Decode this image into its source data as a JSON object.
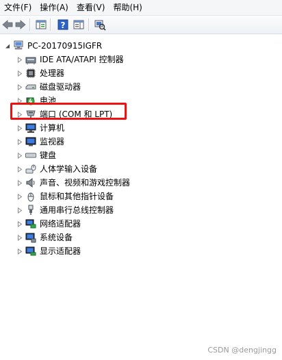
{
  "menubar": {
    "items": [
      "文件(F)",
      "操作(A)",
      "查看(V)",
      "帮助(H)"
    ]
  },
  "toolbar": {
    "buttons": [
      "back-arrow-icon",
      "forward-arrow-icon",
      "show-hide-tree-icon",
      "help-icon",
      "properties-icon",
      "scan-hardware-icon"
    ]
  },
  "tree": {
    "root": "PC-20170915IGFR",
    "categories": [
      {
        "label": "IDE ATA/ATAPI 控制器",
        "icon": "ide-controller-icon"
      },
      {
        "label": "处理器",
        "icon": "processor-icon"
      },
      {
        "label": "磁盘驱动器",
        "icon": "disk-drive-icon"
      },
      {
        "label": "电池",
        "icon": "battery-icon"
      },
      {
        "label": "端口 (COM 和 LPT)",
        "icon": "port-icon"
      },
      {
        "label": "计算机",
        "icon": "computer-icon"
      },
      {
        "label": "监视器",
        "icon": "monitor-icon"
      },
      {
        "label": "键盘",
        "icon": "keyboard-icon"
      },
      {
        "label": "人体学输入设备",
        "icon": "hid-icon"
      },
      {
        "label": "声音、视频和游戏控制器",
        "icon": "sound-icon"
      },
      {
        "label": "鼠标和其他指针设备",
        "icon": "mouse-icon"
      },
      {
        "label": "通用串行总线控制器",
        "icon": "usb-icon"
      },
      {
        "label": "网络适配器",
        "icon": "network-adapter-icon"
      },
      {
        "label": "系统设备",
        "icon": "system-device-icon"
      },
      {
        "label": "显示适配器",
        "icon": "display-adapter-icon"
      }
    ],
    "highlighted": "端口 (COM 和 LPT)",
    "highlight_color": "#ee1111"
  },
  "watermark": "CSDN @dengjingg"
}
